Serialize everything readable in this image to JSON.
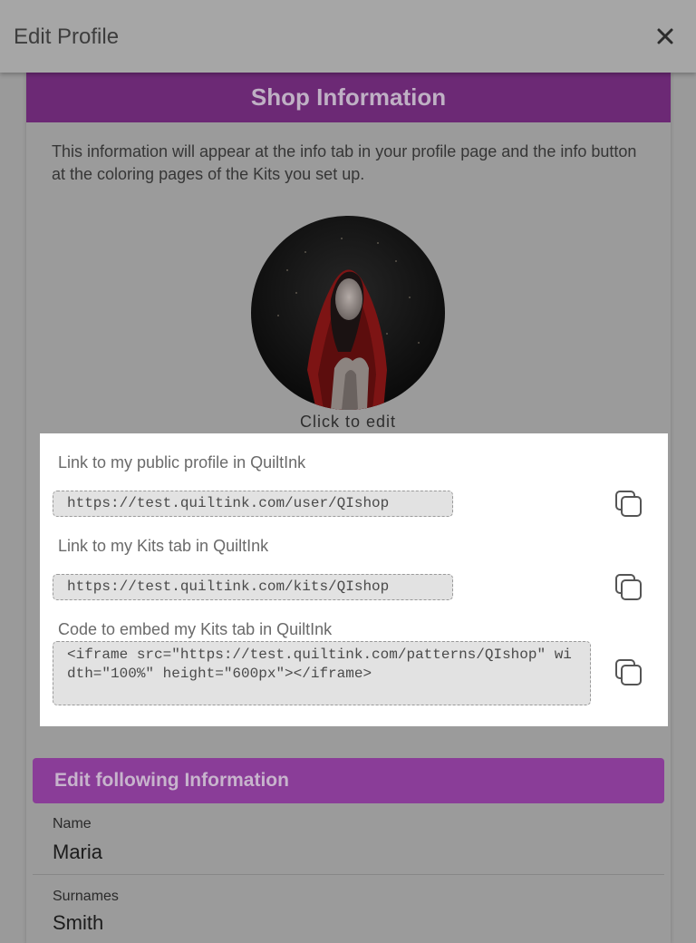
{
  "dialog": {
    "title": "Edit Profile",
    "close_icon": "close-icon"
  },
  "shop_info": {
    "header": "Shop Information",
    "description": "This information will appear at the info tab in your profile page and the info button at the coloring pages of the Kits you set up.",
    "avatar_hint": "Click to edit"
  },
  "links": [
    {
      "label": "Link to my public profile in QuiltInk",
      "value": "https://test.quiltink.com/user/QIshop",
      "copy_icon": "copy-icon"
    },
    {
      "label": "Link to my Kits tab in QuiltInk",
      "value": "https://test.quiltink.com/kits/QIshop",
      "copy_icon": "copy-icon"
    },
    {
      "label": "Code to embed my Kits tab in QuiltInk",
      "value": "<iframe src=\"https://test.quiltink.com/patterns/QIshop\" width=\"100%\" height=\"600px\"></iframe>",
      "copy_icon": "copy-icon"
    }
  ],
  "edit_section": {
    "header": "Edit following Information",
    "fields": [
      {
        "label": "Name",
        "value": "Maria"
      },
      {
        "label": "Surnames",
        "value": "Smith"
      }
    ]
  },
  "colors": {
    "accent": "#8a3d98",
    "header": "#6c2975",
    "overlay": "#9a9a9a"
  }
}
